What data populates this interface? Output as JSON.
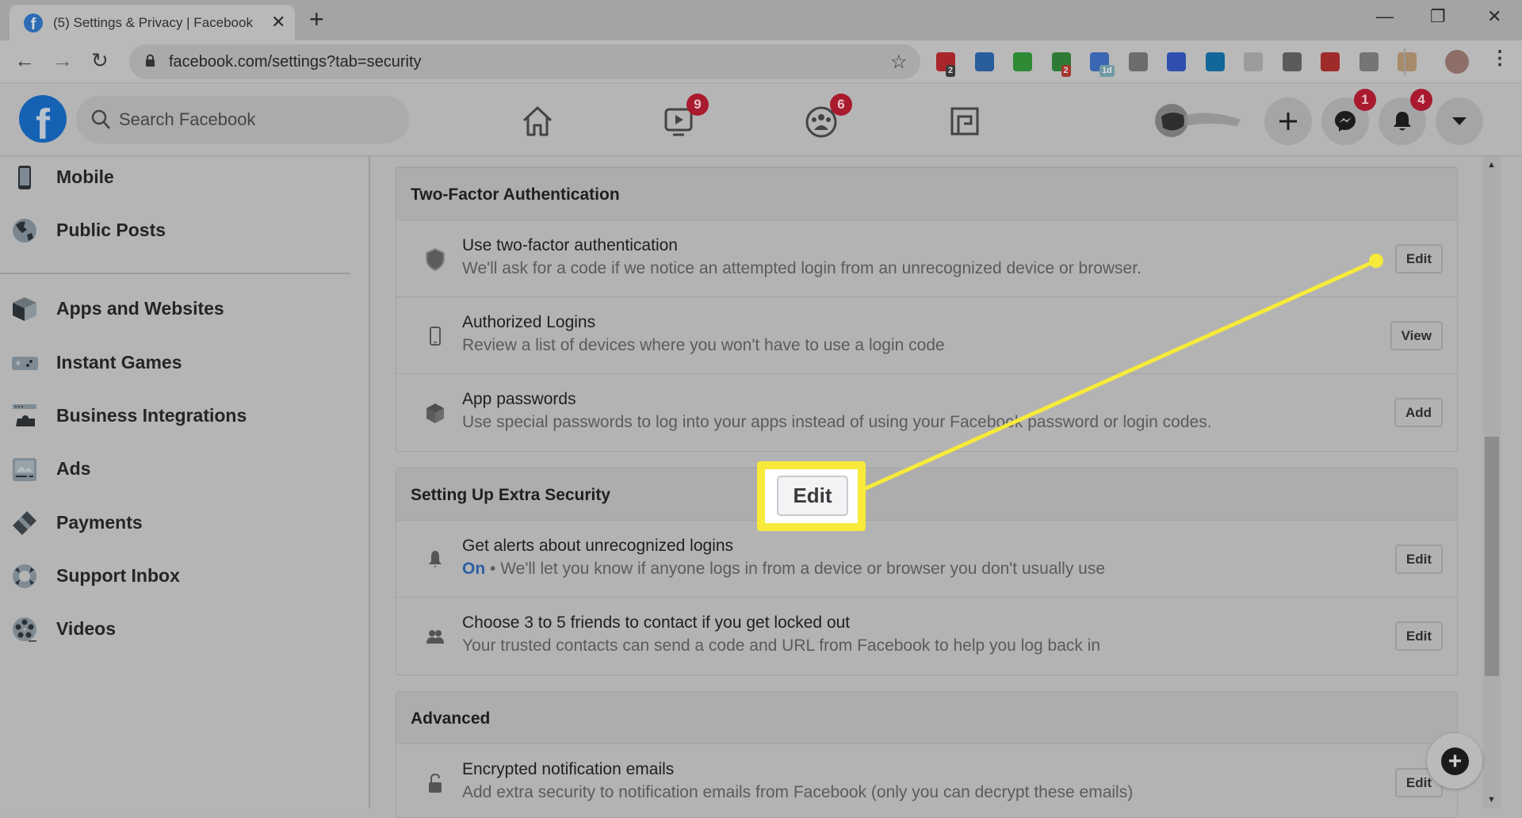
{
  "browser": {
    "tab_title": "(5) Settings & Privacy | Facebook",
    "tab_close": "✕",
    "new_tab": "+",
    "url": "facebook.com/settings?tab=security",
    "window_controls": {
      "minimize": "—",
      "restore": "❐",
      "close": "✕"
    },
    "extensions": [
      {
        "name": "lastpass",
        "color": "#a8262a",
        "badge": "2"
      },
      {
        "name": "funnel",
        "color": "#2a5d9c",
        "badge": ""
      },
      {
        "name": "evernote",
        "color": "#2e8a35",
        "badge": ""
      },
      {
        "name": "ext-green",
        "color": "#2e7a35",
        "badge": "2"
      },
      {
        "name": "calendar",
        "color": "#3a66b3",
        "badge": "1d"
      },
      {
        "name": "cardinal",
        "color": "#6d6d6d",
        "badge": ""
      },
      {
        "name": "vimeo",
        "color": "#2f4fb0",
        "badge": ""
      },
      {
        "name": "ring",
        "color": "#12669a",
        "badge": ""
      },
      {
        "name": "doc-add",
        "color": "#9c9c9c",
        "badge": ""
      },
      {
        "name": "sphere",
        "color": "#5b5b5b",
        "badge": ""
      },
      {
        "name": "mcafee",
        "color": "#9e2a2a",
        "badge": ""
      },
      {
        "name": "adblock",
        "color": "#757575",
        "badge": ""
      },
      {
        "name": "toolbox",
        "color": "#a88b6a",
        "badge": ""
      }
    ]
  },
  "header": {
    "search_placeholder": "Search Facebook",
    "watch_badge": "9",
    "groups_badge": "6",
    "messenger_badge": "1",
    "notifications_badge": "4",
    "create_label": "+"
  },
  "sidebar": {
    "items": [
      {
        "label": "Mobile",
        "icon": "mobile-icon"
      },
      {
        "label": "Public Posts",
        "icon": "globe-icon"
      },
      {
        "label": "Apps and Websites",
        "icon": "cube-icon"
      },
      {
        "label": "Instant Games",
        "icon": "gamepad-icon"
      },
      {
        "label": "Business Integrations",
        "icon": "puzzle-icon"
      },
      {
        "label": "Ads",
        "icon": "ads-icon"
      },
      {
        "label": "Payments",
        "icon": "card-icon"
      },
      {
        "label": "Support Inbox",
        "icon": "lifebuoy-icon"
      },
      {
        "label": "Videos",
        "icon": "film-reel-icon"
      }
    ]
  },
  "sections": [
    {
      "title": "Two-Factor Authentication",
      "rows": [
        {
          "title": "Use two-factor authentication",
          "desc": "We'll ask for a code if we notice an attempted login from an unrecognized device or browser.",
          "button": "Edit",
          "icon": "shield-icon"
        },
        {
          "title": "Authorized Logins",
          "desc": "Review a list of devices where you won't have to use a login code",
          "button": "View",
          "icon": "phone-icon"
        },
        {
          "title": "App passwords",
          "desc": "Use special passwords to log into your apps instead of using your Facebook password or login codes.",
          "button": "Add",
          "icon": "cube-icon"
        }
      ]
    },
    {
      "title": "Setting Up Extra Security",
      "rows": [
        {
          "title": "Get alerts about unrecognized logins",
          "status": "On",
          "desc": " • We'll let you know if anyone logs in from a device or browser you don't usually use",
          "button": "Edit",
          "icon": "bell-icon"
        },
        {
          "title": "Choose 3 to 5 friends to contact if you get locked out",
          "desc": "Your trusted contacts can send a code and URL from Facebook to help you log back in",
          "button": "Edit",
          "icon": "friends-icon"
        }
      ]
    },
    {
      "title": "Advanced",
      "rows": [
        {
          "title": "Encrypted notification emails",
          "desc": "Add extra security to notification emails from Facebook (only you can decrypt these emails)",
          "button": "Edit",
          "icon": "lock-icon"
        }
      ]
    }
  ],
  "callout": {
    "label": "Edit",
    "color": "#f7ea3a"
  },
  "colors": {
    "facebook_blue": "#1877f2",
    "badge_red": "#e41e3f",
    "on_blue": "#2c5fa6",
    "highlight_yellow": "#f7ea3a"
  }
}
